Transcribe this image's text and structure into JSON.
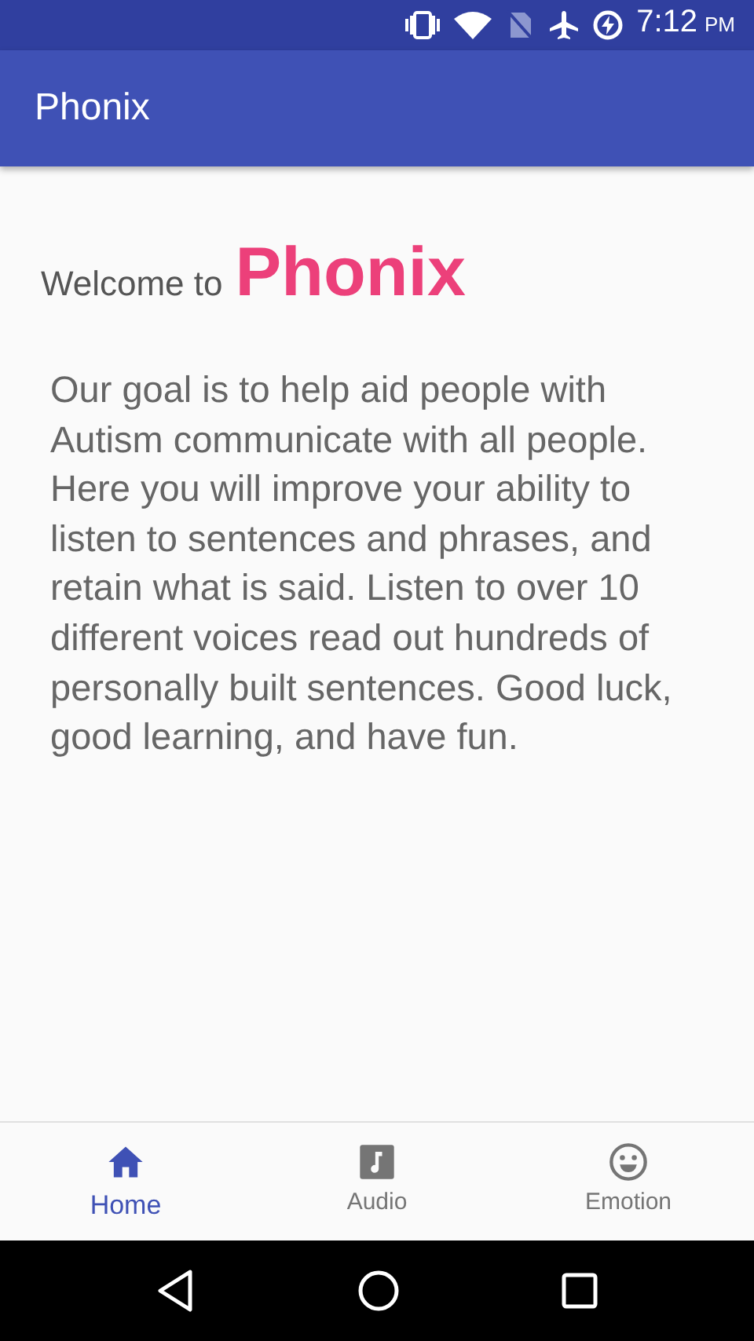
{
  "status_bar": {
    "time": "7:12",
    "meridiem": "PM"
  },
  "app_bar": {
    "title": "Phonix"
  },
  "welcome": {
    "prefix": "Welcome to",
    "brand": "Phonix"
  },
  "description": "Our goal is to help aid people with Autism communicate with all people. Here you will improve your ability to listen to sentences and phrases, and retain what is said. Listen to over 10 different voices read out hundreds of personally built sentences. Good luck, good learning, and have fun.",
  "bottom_nav": [
    {
      "kind": "home",
      "label": "Home",
      "selected": true
    },
    {
      "kind": "audio",
      "label": "Audio",
      "selected": false
    },
    {
      "kind": "emotion",
      "label": "Emotion",
      "selected": false
    }
  ]
}
